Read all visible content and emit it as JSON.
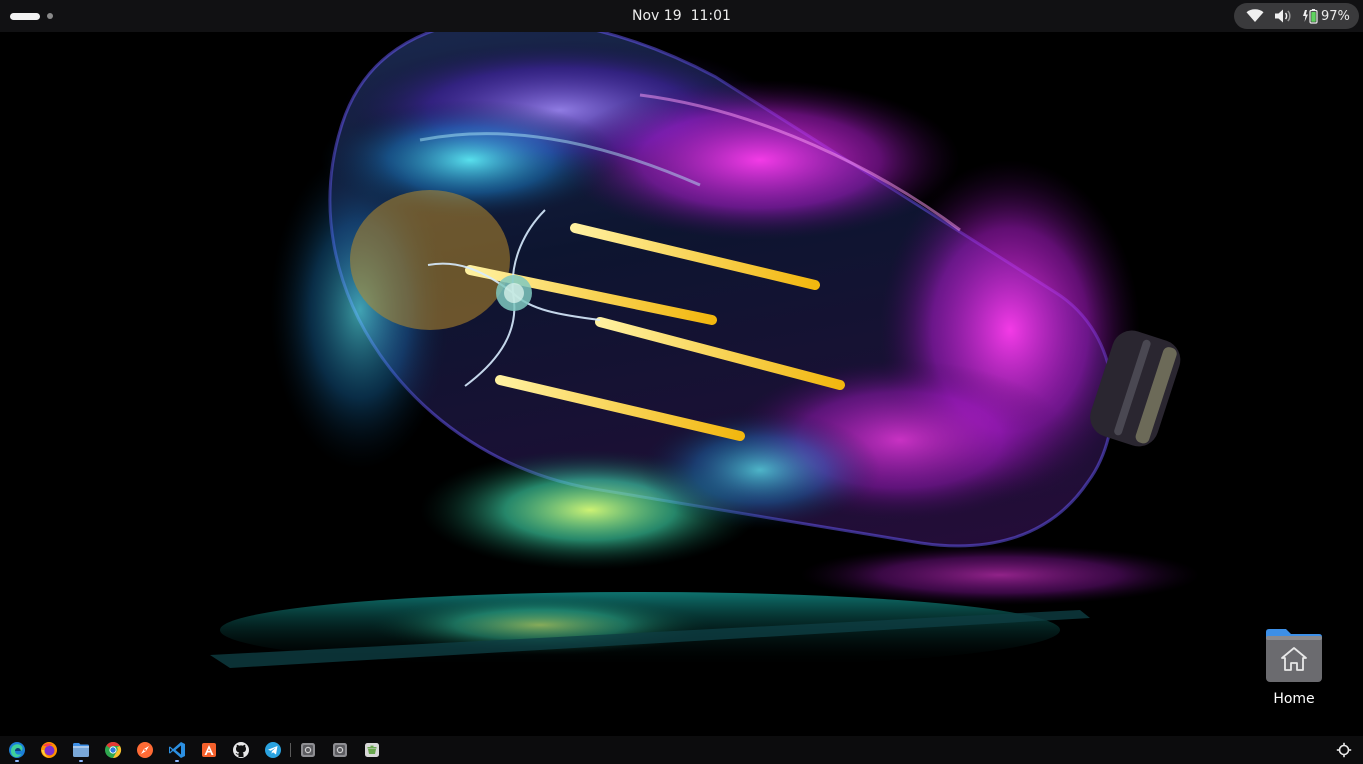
{
  "top_panel": {
    "activities": {
      "active_workspace": "workspace-1",
      "workspace_count": 2
    },
    "date": "Nov 19",
    "time": "11:01",
    "system_tray": {
      "icons": [
        "wifi-icon",
        "volume-icon",
        "battery-charging-icon"
      ],
      "battery_percent": "97%"
    }
  },
  "desktop": {
    "wallpaper": "neon-light-bulb",
    "icons": [
      {
        "name": "Home",
        "icon": "home-folder-icon"
      }
    ]
  },
  "taskbar": {
    "apps": [
      {
        "name": "microsoft-edge-icon",
        "color": "#1fa5e0"
      },
      {
        "name": "firefox-icon",
        "color": "#ff7a1c"
      },
      {
        "name": "files-icon",
        "color": "#4a90d9"
      },
      {
        "name": "chrome-icon",
        "color": "#2fa84f"
      },
      {
        "name": "compass-icon",
        "color": "#ff6b35"
      },
      {
        "name": "vscode-icon",
        "color": "#2c8fe0"
      },
      {
        "name": "software-center-icon",
        "color": "#f4602b"
      },
      {
        "name": "github-icon",
        "color": "#e8e8e8"
      },
      {
        "name": "telegram-icon",
        "color": "#2aa3e0"
      },
      {
        "name": "window-icon-1",
        "color": "#9a9a9a"
      },
      {
        "name": "window-icon-2",
        "color": "#9a9a9a"
      },
      {
        "name": "recycle-icon",
        "color": "#9ccb5c"
      }
    ],
    "tray_icon": "network-status-icon"
  },
  "colors": {
    "panel_bg": "#111113",
    "taskbar_bg": "#0c0c0d",
    "tray_pill": "#3a3a3c",
    "battery_green": "#5fd35f"
  }
}
